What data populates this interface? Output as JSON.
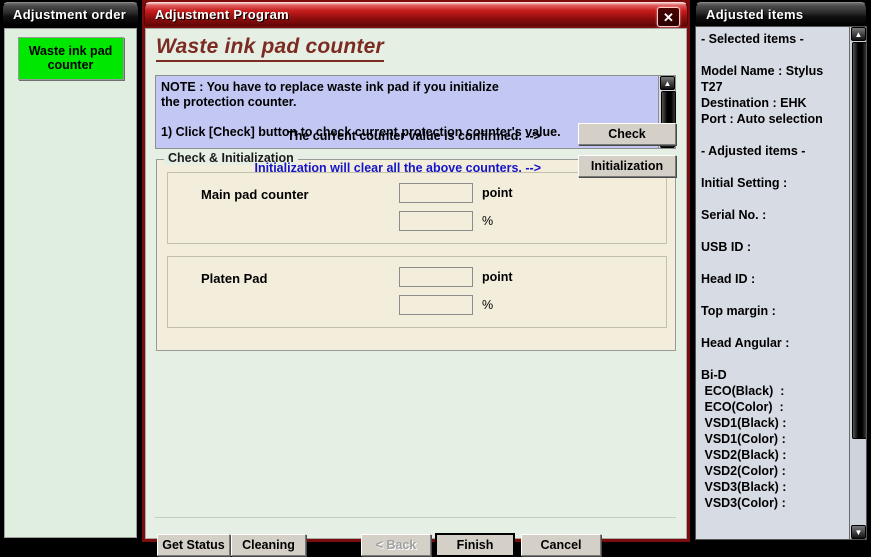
{
  "left_panel": {
    "title": "Adjustment order",
    "items": [
      {
        "label": "Waste ink pad counter",
        "selected": true,
        "color": "#00e800"
      }
    ]
  },
  "main_window": {
    "title": "Adjustment Program",
    "close_icon": "close-icon",
    "close_glyph": "✕",
    "page_title": "Waste ink pad counter",
    "note": {
      "text": "NOTE : You have to replace waste ink pad if you initialize\nthe protection counter.\n\n1) Click [Check] button to check current protection counter's value.",
      "scroll_up_glyph": "▲",
      "scroll_down_glyph": "▼"
    },
    "group": {
      "legend": "Check & Initialization",
      "rows": [
        {
          "label": "Main pad counter",
          "point_value": "",
          "point_unit": "point",
          "percent_value": "",
          "percent_unit": "%"
        },
        {
          "label": "Platen Pad",
          "point_value": "",
          "point_unit": "point",
          "percent_value": "",
          "percent_unit": "%"
        }
      ]
    },
    "confirm": {
      "check_text": "The current counter value is confirmed. -->",
      "check_button": "Check",
      "init_text": "Initialization will clear all the above counters. -->",
      "init_text_color": "#1414c8",
      "init_button": "Initialization"
    },
    "footer_buttons": {
      "get_status": "Get Status",
      "cleaning": "Cleaning",
      "back": "< Back",
      "finish": "Finish",
      "cancel": "Cancel"
    }
  },
  "right_panel": {
    "title": "Adjusted items",
    "content": "- Selected items -\n\nModel Name : Stylus\nT27\nDestination : EHK\nPort : Auto selection\n\n- Adjusted items -\n\nInitial Setting :\n\nSerial No. :\n\nUSB ID :\n\nHead ID :\n\nTop margin :\n\nHead Angular :\n\nBi-D\n ECO(Black)  :\n ECO(Color)  :\n VSD1(Black) :\n VSD1(Color) :\n VSD2(Black) :\n VSD2(Color) :\n VSD3(Black) :\n VSD3(Color) :",
    "scroll_up_glyph": "▲",
    "scroll_down_glyph": "▼"
  }
}
